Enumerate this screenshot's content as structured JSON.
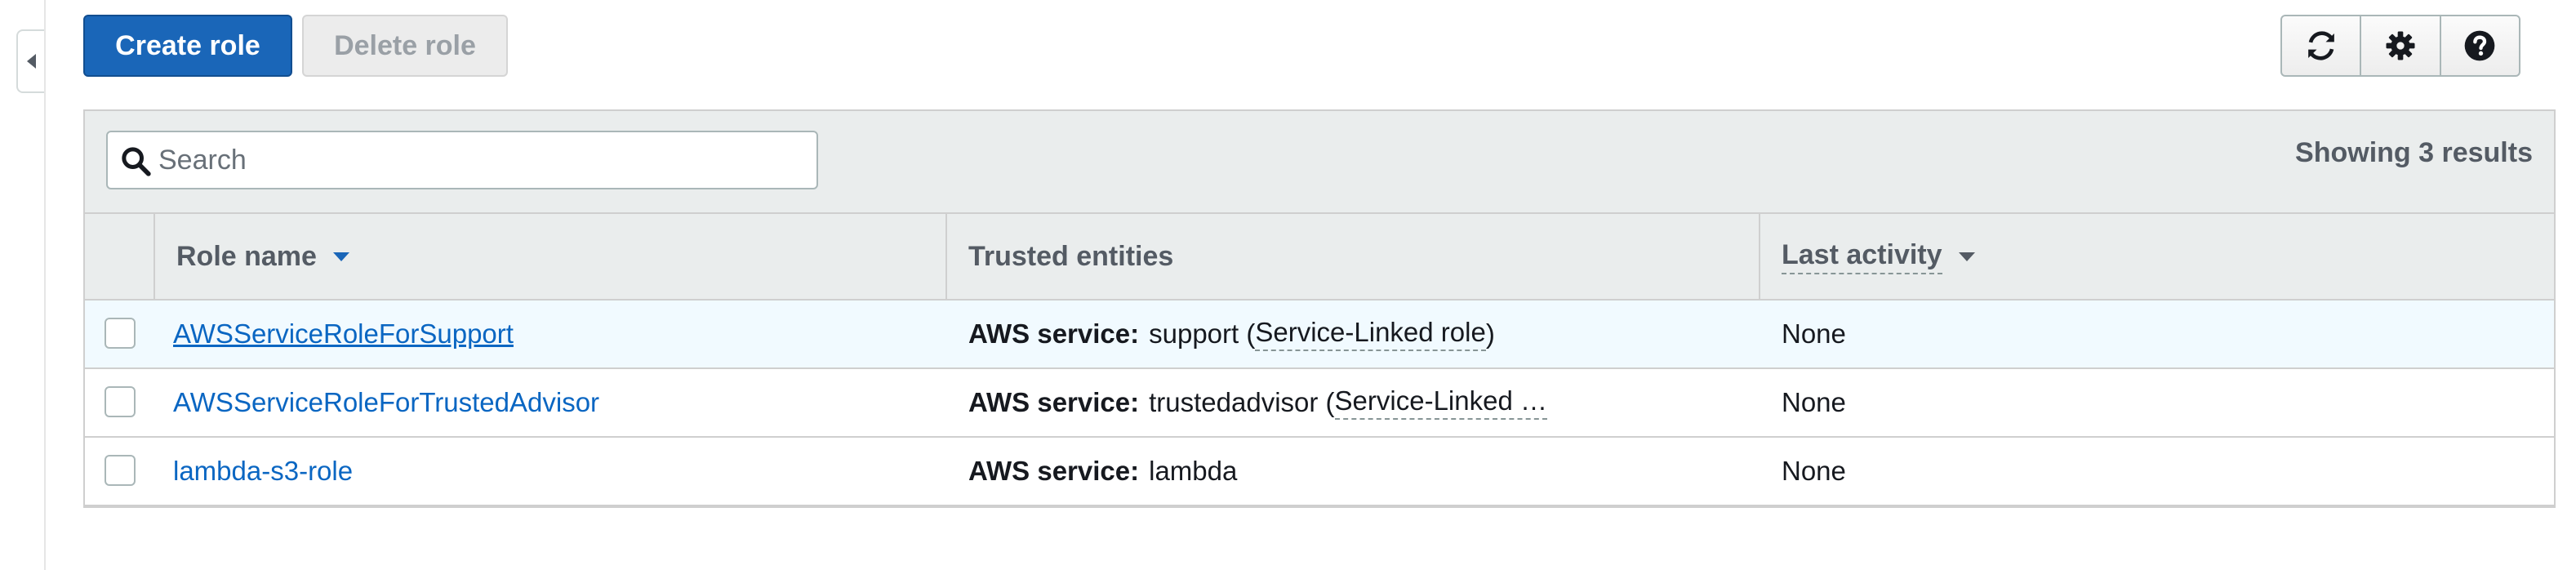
{
  "toolbar": {
    "create_label": "Create role",
    "delete_label": "Delete role",
    "icons": [
      "refresh-icon",
      "gear-icon",
      "help-icon"
    ]
  },
  "search": {
    "placeholder": "Search",
    "value": ""
  },
  "results_text": "Showing 3 results",
  "columns": {
    "role_name": "Role name",
    "trusted_entities": "Trusted entities",
    "last_activity": "Last activity"
  },
  "rows": [
    {
      "role": "AWSServiceRoleForSupport",
      "entity_prefix": "AWS service:",
      "entity_service": "support",
      "entity_paren_open": " (",
      "entity_linked": "Service-Linked role",
      "entity_paren_close": ")",
      "last_activity": "None"
    },
    {
      "role": "AWSServiceRoleForTrustedAdvisor",
      "entity_prefix": "AWS service:",
      "entity_service": "trustedadvisor",
      "entity_paren_open": " (",
      "entity_linked": "Service-Linked …",
      "entity_paren_close": "",
      "last_activity": "None"
    },
    {
      "role": "lambda-s3-role",
      "entity_prefix": "AWS service:",
      "entity_service": "lambda",
      "entity_paren_open": "",
      "entity_linked": "",
      "entity_paren_close": "",
      "last_activity": "None"
    }
  ],
  "colors": {
    "primary": "#1a66b8",
    "link": "#0a66c2",
    "header_bg": "#eaeded",
    "row_highlight": "#f1faff"
  }
}
